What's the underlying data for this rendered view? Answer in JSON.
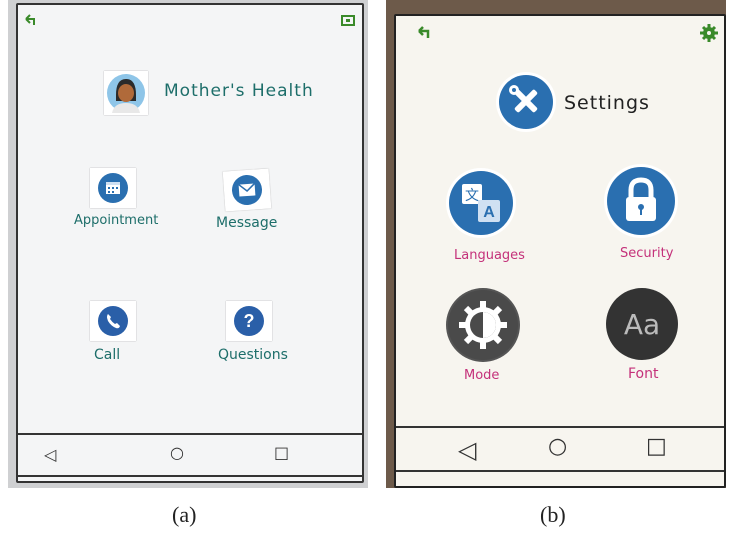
{
  "panel_a": {
    "title": "Mother's Health",
    "items": [
      {
        "label": "Appointment",
        "icon": "calendar-icon"
      },
      {
        "label": "Message",
        "icon": "envelope-icon"
      },
      {
        "label": "Call",
        "icon": "phone-icon"
      },
      {
        "label": "Questions",
        "icon": "question-icon"
      }
    ],
    "nav": {
      "back": "◁",
      "home": "○",
      "recent": "□"
    },
    "caption": "(a)"
  },
  "panel_b": {
    "title": "Settings",
    "items": [
      {
        "label": "Languages",
        "icon": "translate-icon"
      },
      {
        "label": "Security",
        "icon": "lock-icon"
      },
      {
        "label": "Mode",
        "icon": "contrast-gear-icon"
      },
      {
        "label": "Font",
        "icon": "font-aa-icon",
        "glyph": "Aa"
      }
    ],
    "nav": {
      "back": "◁",
      "home": "○",
      "recent": "□"
    },
    "caption": "(b)"
  },
  "colors": {
    "teal_text": "#1d6e6a",
    "pink_text": "#c4317a",
    "icon_blue": "#2a6fb0",
    "icon_grey": "#4a4a4a",
    "corner_green": "#3a8a2a"
  }
}
